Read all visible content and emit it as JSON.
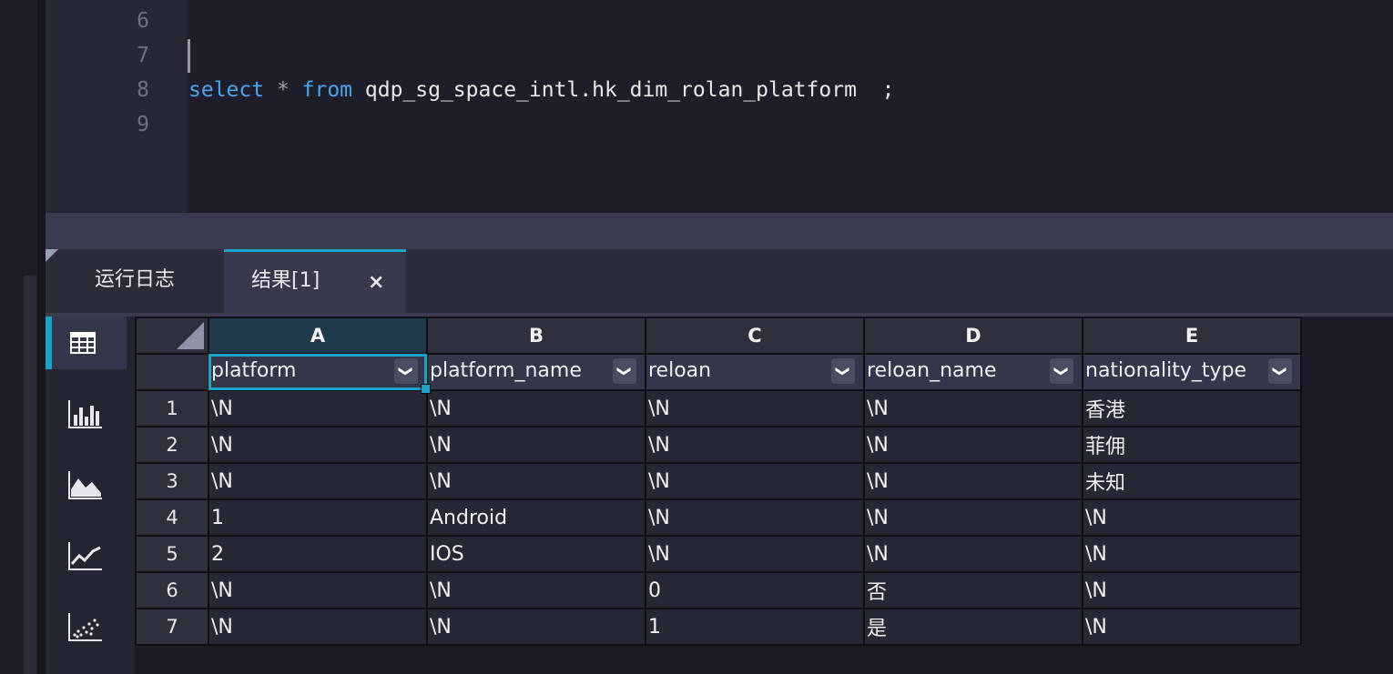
{
  "editor": {
    "lines": [
      {
        "number": "6",
        "code": ""
      },
      {
        "number": "7",
        "code": ""
      },
      {
        "number": "8",
        "kw1": "select",
        "star": " * ",
        "kw2": "from",
        "rest": " qdp_sg_space_intl.hk_dim_rolan_platform  ;"
      },
      {
        "number": "9",
        "code": ""
      }
    ]
  },
  "tabs": {
    "log_label": "运行日志",
    "result_label": "结果[1]",
    "close_glyph": "×"
  },
  "sidebar": {
    "buttons": [
      "table-view",
      "bar-chart-view",
      "area-chart-view",
      "line-chart-view",
      "scatter-chart-view"
    ],
    "active": "table-view"
  },
  "grid": {
    "column_letters": [
      "A",
      "B",
      "C",
      "D",
      "E"
    ],
    "fields": [
      "platform",
      "platform_name",
      "reloan",
      "reloan_name",
      "nationality_type"
    ],
    "dropdown_glyph": "❯",
    "rows": [
      {
        "num": "1",
        "cells": [
          "\\N",
          "\\N",
          "\\N",
          "\\N",
          "香港"
        ]
      },
      {
        "num": "2",
        "cells": [
          "\\N",
          "\\N",
          "\\N",
          "\\N",
          "菲佣"
        ]
      },
      {
        "num": "3",
        "cells": [
          "\\N",
          "\\N",
          "\\N",
          "\\N",
          "未知"
        ]
      },
      {
        "num": "4",
        "cells": [
          "1",
          "Android",
          "\\N",
          "\\N",
          "\\N"
        ]
      },
      {
        "num": "5",
        "cells": [
          "2",
          "IOS",
          "\\N",
          "\\N",
          "\\N"
        ]
      },
      {
        "num": "6",
        "cells": [
          "\\N",
          "\\N",
          "0",
          "否",
          "\\N"
        ]
      },
      {
        "num": "7",
        "cells": [
          "\\N",
          "\\N",
          "1",
          "是",
          "\\N"
        ]
      }
    ]
  },
  "colors": {
    "accent": "#1aa5c8",
    "keyword": "#4aa6f0",
    "editor_bg": "#1d1e29",
    "grid_cell_bg": "#262835"
  }
}
